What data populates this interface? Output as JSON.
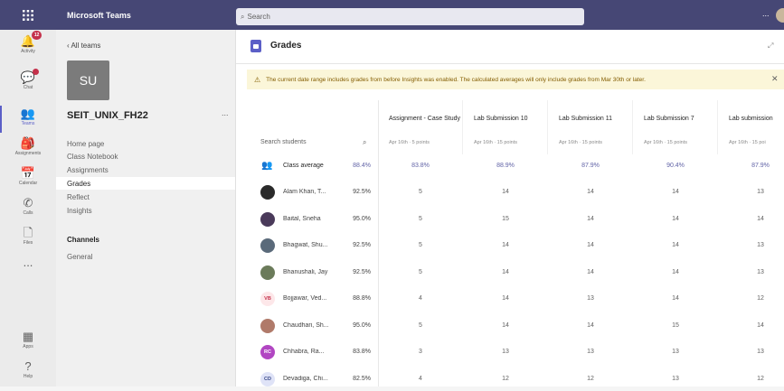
{
  "topbar": {
    "app_title": "Microsoft Teams",
    "search_placeholder": "Search",
    "more": "..."
  },
  "rail": [
    {
      "label": "Activity",
      "icon": "bell-icon",
      "badge": "12"
    },
    {
      "label": "Chat",
      "icon": "chat-icon",
      "dot": true
    },
    {
      "label": "Teams",
      "icon": "teams-icon",
      "active": true
    },
    {
      "label": "Assignments",
      "icon": "assignments-icon"
    },
    {
      "label": "Calendar",
      "icon": "calendar-icon"
    },
    {
      "label": "Calls",
      "icon": "phone-icon"
    },
    {
      "label": "Files",
      "icon": "file-icon"
    },
    {
      "label": "...",
      "icon": "more-icon"
    },
    {
      "label": "Apps",
      "icon": "apps-icon"
    },
    {
      "label": "Help",
      "icon": "help-icon"
    }
  ],
  "leftpanel": {
    "back_label": "All teams",
    "team_initials": "SU",
    "team_name": "SEIT_UNIX_FH22",
    "more": "...",
    "nav": [
      "Home page",
      "Class Notebook",
      "Assignments",
      "Grades",
      "Reflect",
      "Insights"
    ],
    "active_nav": "Grades",
    "channels_heading": "Channels",
    "channels": [
      "General"
    ]
  },
  "main": {
    "title": "Grades",
    "banner": "The current date range includes grades from before Insights was enabled. The calculated averages will only include grades from Mar 30th or later.",
    "search_placeholder": "Search students",
    "columns": [
      {
        "title": "Assignment - Case Study",
        "sub": "Apr 16th · 5 points"
      },
      {
        "title": "Lab Submission 10",
        "sub": "Apr 16th · 15 points"
      },
      {
        "title": "Lab Submission 11",
        "sub": "Apr 16th · 15 points"
      },
      {
        "title": "Lab Submission 7",
        "sub": "Apr 16th · 15 points"
      },
      {
        "title": "Lab submission",
        "sub": "Apr 16th · 15 poi"
      }
    ],
    "class_average": {
      "label": "Class average",
      "avg": "88.4%",
      "cells": [
        "83.8%",
        "88.9%",
        "87.9%",
        "90.4%",
        "87.9%"
      ]
    },
    "students": [
      {
        "name": "Alam Khan, T...",
        "avg": "92.5%",
        "cells": [
          "5",
          "14",
          "14",
          "14",
          "13"
        ],
        "avatar": "photo",
        "color": "#2a2a2a"
      },
      {
        "name": "Baital, Sneha",
        "avg": "95.0%",
        "cells": [
          "5",
          "15",
          "14",
          "14",
          "14"
        ],
        "avatar": "photo",
        "color": "#4a3a5a"
      },
      {
        "name": "Bhagwat, Shu...",
        "avg": "92.5%",
        "cells": [
          "5",
          "14",
          "14",
          "14",
          "13"
        ],
        "avatar": "photo",
        "color": "#5a6a7a"
      },
      {
        "name": "Bhanushali, Jay",
        "avg": "92.5%",
        "cells": [
          "5",
          "14",
          "14",
          "14",
          "13"
        ],
        "avatar": "photo",
        "color": "#6b7b5a"
      },
      {
        "name": "Bojjawar, Ved...",
        "avg": "88.8%",
        "cells": [
          "4",
          "14",
          "13",
          "14",
          "12"
        ],
        "avatar": "VB",
        "color": "#fde7e9",
        "fg": "#c4314b"
      },
      {
        "name": "Chaudhari, Sh...",
        "avg": "95.0%",
        "cells": [
          "5",
          "14",
          "14",
          "15",
          "14"
        ],
        "avatar": "photo",
        "color": "#b07a6a"
      },
      {
        "name": "Chhabra, Ra...",
        "avg": "83.8%",
        "cells": [
          "3",
          "13",
          "13",
          "13",
          "13"
        ],
        "avatar": "RC",
        "color": "#b146c2",
        "fg": "#ffffff"
      },
      {
        "name": "Devadiga, Chi...",
        "avg": "82.5%",
        "cells": [
          "4",
          "12",
          "12",
          "13",
          "12"
        ],
        "avatar": "CD",
        "color": "#dfe3f7",
        "fg": "#3a4a8a"
      }
    ]
  }
}
